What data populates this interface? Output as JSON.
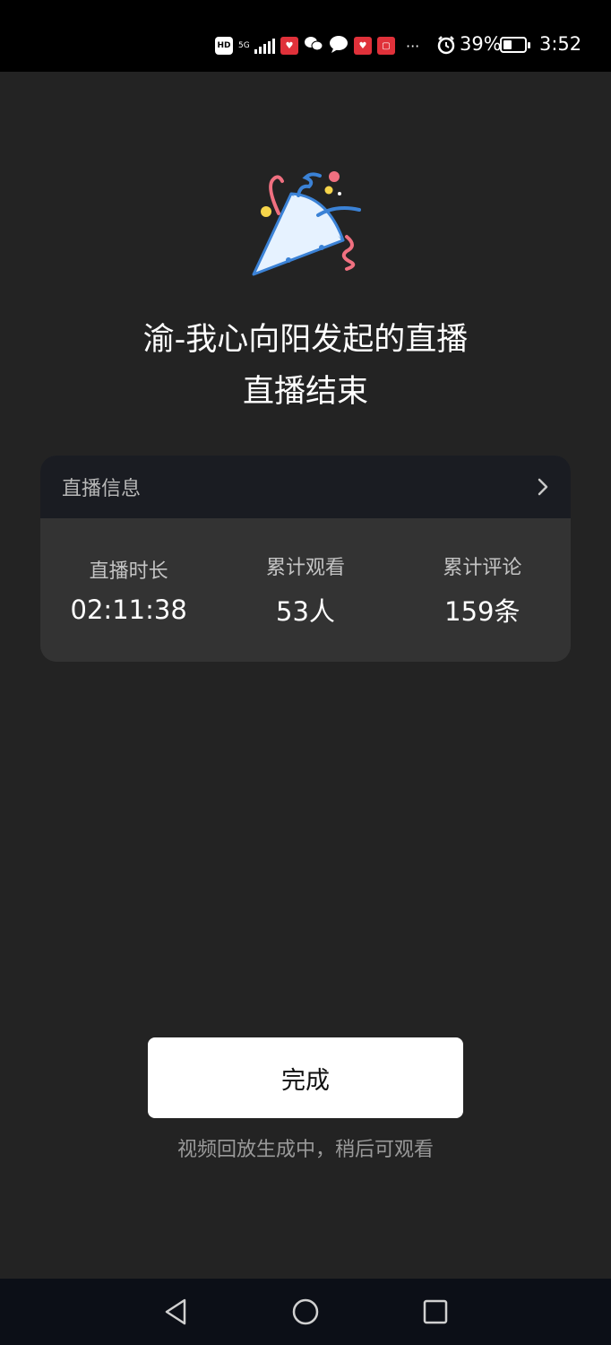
{
  "status_bar": {
    "hd_label": "HD",
    "network_label": "5G",
    "more_label": "···",
    "battery_percent": "39%",
    "battery_level": 0.39,
    "time": "3:52"
  },
  "title": {
    "line1": "渝-我心向阳发起的直播",
    "line2": "直播结束"
  },
  "info": {
    "header_label": "直播信息",
    "stats": [
      {
        "label": "直播时长",
        "value": "02:11:38"
      },
      {
        "label": "累计观看",
        "value": "53人"
      },
      {
        "label": "累计评论",
        "value": "159条"
      }
    ]
  },
  "done_button_label": "完成",
  "replay_note": "视频回放生成中，稍后可观看",
  "colors": {
    "background": "#232323",
    "card": "#333333",
    "card_header": "#1a1c22",
    "button": "#ffffff",
    "nav_bar": "#0c0f17"
  },
  "icons": {
    "party": "party-popper-icon",
    "chevron": "chevron-right-icon",
    "nav_back": "back-triangle-icon",
    "nav_home": "home-circle-icon",
    "nav_recents": "recents-square-icon"
  }
}
